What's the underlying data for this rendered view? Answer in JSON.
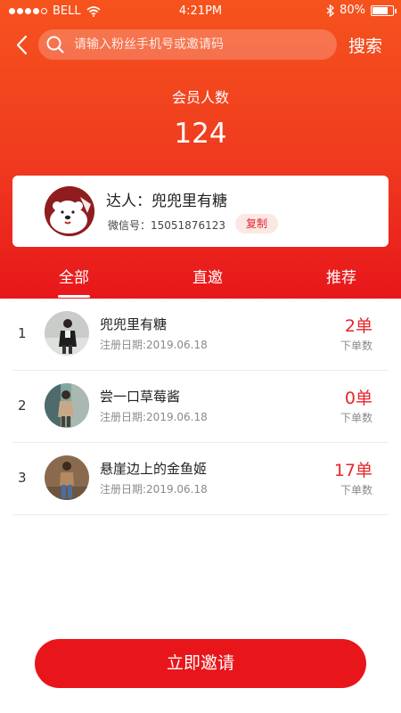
{
  "status_bar": {
    "carrier": "BELL",
    "time": "4:21PM",
    "battery_percent": "80%",
    "battery_level": 0.8
  },
  "nav": {
    "search_placeholder": "请输入粉丝手机号或邀请码",
    "search_button": "搜索"
  },
  "stats": {
    "label": "会员人数",
    "value": "124"
  },
  "profile": {
    "title": "达人：兜兜里有糖",
    "wechat": "微信号：15051876123",
    "copy_label": "复制"
  },
  "tabs": [
    {
      "label": "全部",
      "active": true
    },
    {
      "label": "直邀",
      "active": false
    },
    {
      "label": "推荐",
      "active": false
    }
  ],
  "members": [
    {
      "rank": "1",
      "name": "兜兜里有糖",
      "date": "注册日期:2019.06.18",
      "orders": "2单",
      "orders_label": "下单数"
    },
    {
      "rank": "2",
      "name": "尝一口草莓酱",
      "date": "注册日期:2019.06.18",
      "orders": "0单",
      "orders_label": "下单数"
    },
    {
      "rank": "3",
      "name": "悬崖边上的金鱼姬",
      "date": "注册日期:2019.06.18",
      "orders": "17单",
      "orders_label": "下单数"
    }
  ],
  "invite_button": "立即邀请",
  "colors": {
    "accent": "#e8161b",
    "header_top": "#f6531d"
  }
}
